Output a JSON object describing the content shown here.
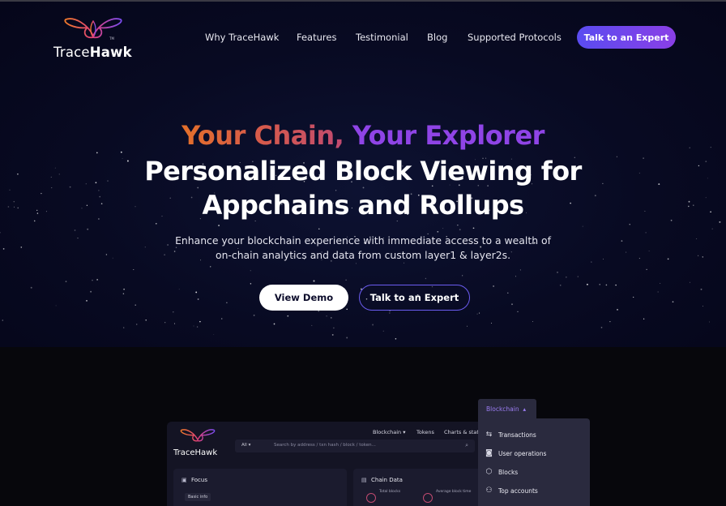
{
  "brand": {
    "name_part1": "Trace",
    "name_part2": "Hawk"
  },
  "nav": {
    "items": [
      "Why TraceHawk",
      "Features",
      "Testimonial",
      "Blog",
      "Supported Protocols"
    ],
    "cta": "Talk to an Expert"
  },
  "hero": {
    "tagline_part1": "Your Chain,",
    "tagline_part2": "Your Explorer",
    "heading_line1": "Personalized Block Viewing for",
    "heading_line2": "Appchains and Rollups",
    "sub_line1": "Enhance your blockchain experience with immediate access to a wealth of",
    "sub_line2": "on-chain analytics and data from custom layer1 & layer2s.",
    "btn_demo": "View Demo",
    "btn_expert": "Talk to an Expert"
  },
  "mockup": {
    "logo": "TraceHawk",
    "nav": [
      "Blockchain",
      "Tokens",
      "Charts & stats"
    ],
    "search_filter": "All",
    "search_placeholder": "Search by address / txn hash / block / token...",
    "card_focus_title": "Focus",
    "card_focus_chip": "Basic info",
    "card_chain_title": "Chain Data",
    "stat1": "Total blocks",
    "stat2": "Average block time"
  },
  "dropdown": {
    "tab": "Blockchain",
    "items": [
      "Transactions",
      "User operations",
      "Blocks",
      "Top accounts"
    ]
  },
  "colors": {
    "accent": "#7c4ff0",
    "orange": "#e36f2a",
    "purple": "#8f44e6",
    "background": "#080a22"
  }
}
